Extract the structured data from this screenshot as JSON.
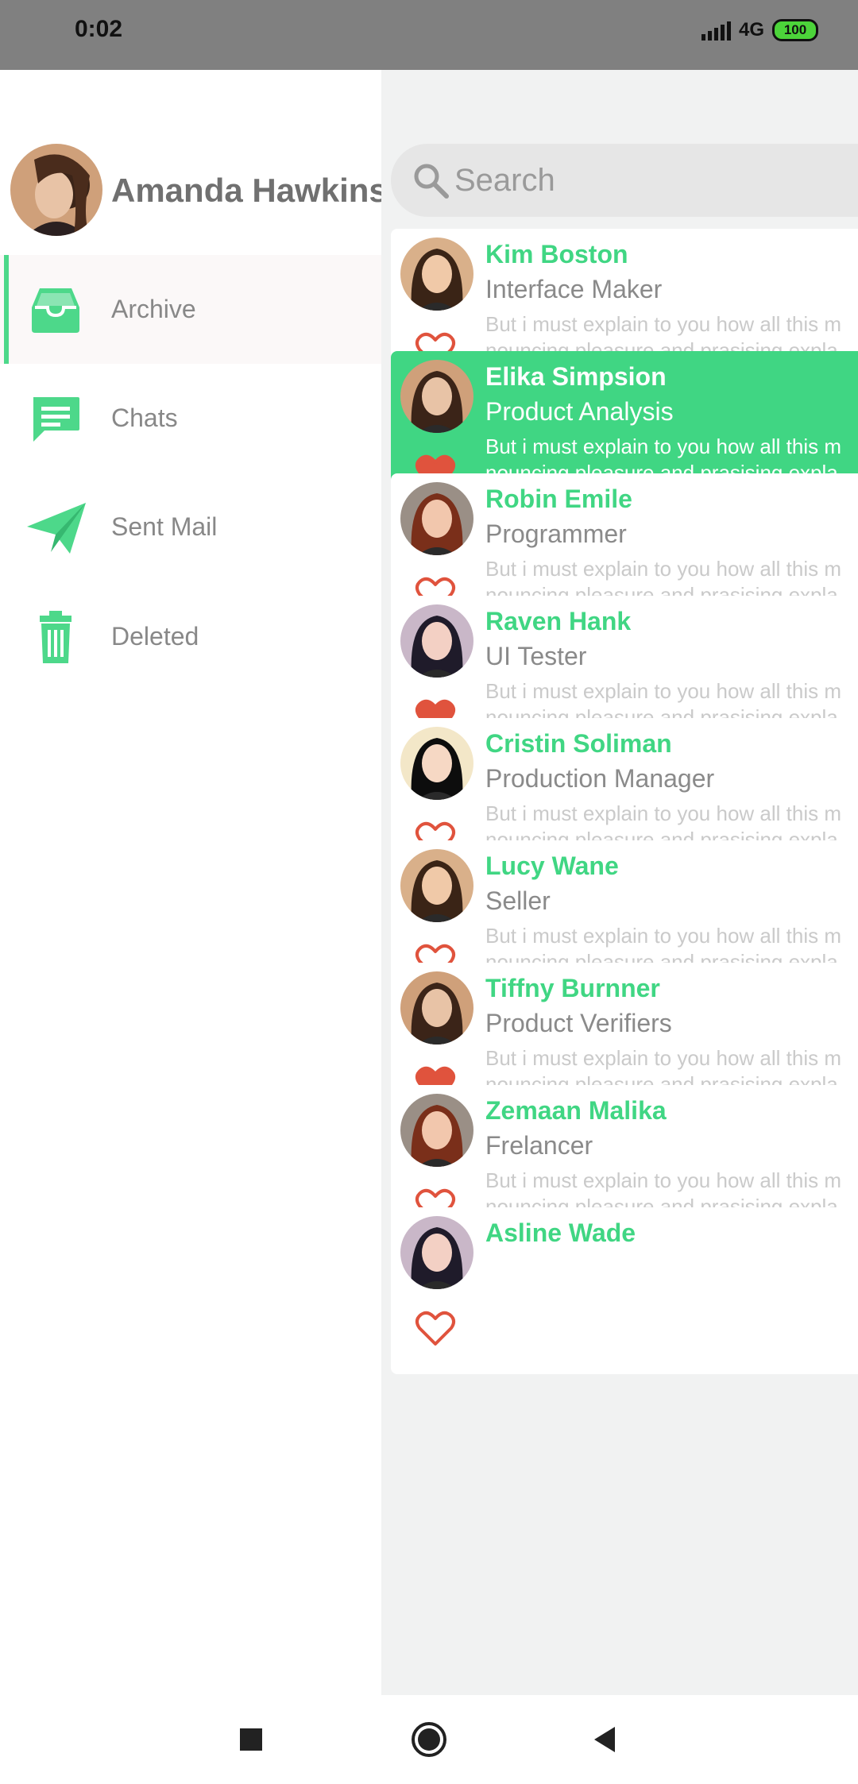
{
  "status_bar": {
    "time": "0:02",
    "network": "4G",
    "battery": "100"
  },
  "drawer": {
    "user_name": "Amanda Hawkins",
    "items": [
      {
        "label": "Archive",
        "icon": "archive-icon",
        "active": true
      },
      {
        "label": "Chats",
        "icon": "chat-icon",
        "active": false
      },
      {
        "label": "Sent Mail",
        "icon": "send-icon",
        "active": false
      },
      {
        "label": "Deleted",
        "icon": "trash-icon",
        "active": false
      }
    ]
  },
  "search": {
    "placeholder": "Search"
  },
  "messages": [
    {
      "name": "Kim Boston",
      "role": "Interface Maker",
      "preview_line1": "But i must explain to you how all this m",
      "preview_line2": "nouncing pleasure and prasising expla",
      "favorite": false,
      "selected": false
    },
    {
      "name": "Elika Simpsion",
      "role": "Product Analysis",
      "preview_line1": "But i must explain to you how all this m",
      "preview_line2": "nouncing pleasure and prasising expla",
      "favorite": true,
      "selected": true
    },
    {
      "name": "Robin Emile",
      "role": "Programmer",
      "preview_line1": "But i must explain to you how all this m",
      "preview_line2": "nouncing pleasure and prasising expla",
      "favorite": false,
      "selected": false
    },
    {
      "name": "Raven Hank",
      "role": "UI Tester",
      "preview_line1": "But i must explain to you how all this m",
      "preview_line2": "nouncing pleasure and prasising expla",
      "favorite": true,
      "selected": false
    },
    {
      "name": "Cristin Soliman",
      "role": "Production Manager",
      "preview_line1": "But i must explain to you how all this m",
      "preview_line2": "nouncing pleasure and prasising expla",
      "favorite": false,
      "selected": false
    },
    {
      "name": "Lucy Wane",
      "role": "Seller",
      "preview_line1": "But i must explain to you how all this m",
      "preview_line2": "nouncing pleasure and prasising expla",
      "favorite": false,
      "selected": false
    },
    {
      "name": "Tiffny Burnner",
      "role": "Product Verifiers",
      "preview_line1": "But i must explain to you how all this m",
      "preview_line2": "nouncing pleasure and prasising expla",
      "favorite": true,
      "selected": false
    },
    {
      "name": "Zemaan Malika",
      "role": "Frelancer",
      "preview_line1": "But i must explain to you how all this m",
      "preview_line2": "nouncing pleasure and prasising expla",
      "favorite": false,
      "selected": false
    },
    {
      "name": "Asline Wade",
      "role": "",
      "preview_line1": "",
      "preview_line2": "",
      "favorite": false,
      "selected": false
    }
  ],
  "colors": {
    "accent": "#40d683",
    "heart": "#e0533d",
    "status_bar": "#808080"
  }
}
